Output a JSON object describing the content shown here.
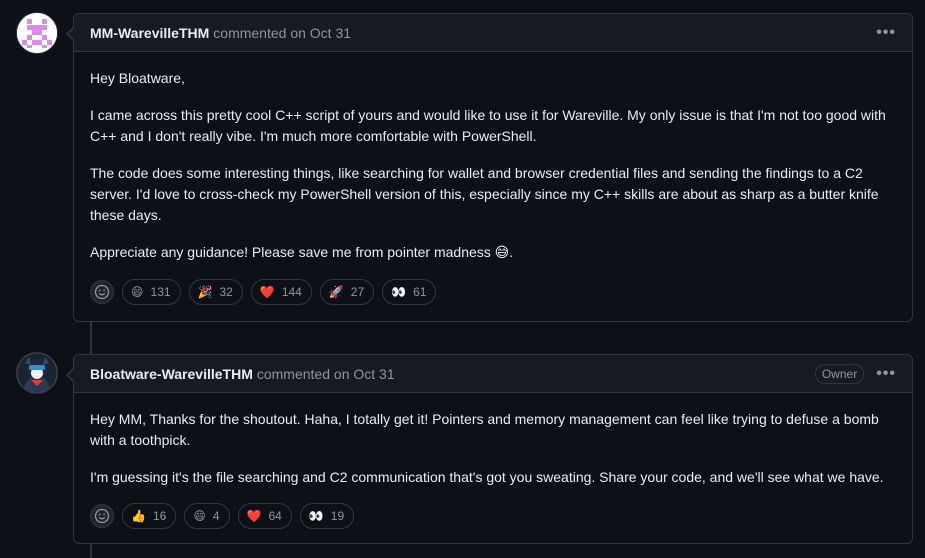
{
  "comments": [
    {
      "author": "MM-WarevilleTHM",
      "action": "commented",
      "date": "on Oct 31",
      "paragraphs": [
        "Hey Bloatware,",
        "I came across this pretty cool C++ script of yours and would like to use it for Wareville. My only issue is that I'm not too good with C++ and I don't really vibe. I'm much more comfortable with PowerShell.",
        "The code does some interesting things, like searching for wallet and browser credential files and sending the findings to a C2 server. I'd love to cross-check my PowerShell version of this, especially since my C++ skills are about as sharp as a butter knife these days.",
        "Appreciate any guidance! Please save me from pointer madness"
      ],
      "trailing_emoji": "😅",
      "trailing_punct": ".",
      "reactions": [
        {
          "emoji": "😄",
          "count": "131",
          "icon": "smile-icon"
        },
        {
          "emoji": "🎉",
          "count": "32",
          "icon": "tada-icon"
        },
        {
          "emoji": "❤️",
          "count": "144",
          "icon": "heart-icon"
        },
        {
          "emoji": "🚀",
          "count": "27",
          "icon": "rocket-icon"
        },
        {
          "emoji": "👀",
          "count": "61",
          "icon": "eyes-icon"
        }
      ]
    },
    {
      "author": "Bloatware-WarevilleTHM",
      "action": "commented",
      "date": "on Oct 31",
      "badge": "Owner",
      "paragraphs": [
        "Hey MM, Thanks for the shoutout. Haha, I totally get it! Pointers and memory management can feel like trying to defuse a bomb with a toothpick.",
        "I'm guessing it's the file searching and C2 communication that's got you sweating. Share your code, and we'll see what we have."
      ],
      "reactions": [
        {
          "emoji": "👍",
          "count": "16",
          "icon": "thumbsup-icon"
        },
        {
          "emoji": "😄",
          "count": "4",
          "icon": "smile-icon"
        },
        {
          "emoji": "❤️",
          "count": "64",
          "icon": "heart-icon"
        },
        {
          "emoji": "👀",
          "count": "19",
          "icon": "eyes-icon"
        }
      ]
    }
  ],
  "colors": {
    "background": "#0d1117",
    "header_bg": "#161b22",
    "border": "#30363d",
    "text": "#e6edf3",
    "muted": "#8d96a0",
    "identicon": "#d98ce8"
  },
  "icons": {
    "kebab": "kebab-horizontal-icon",
    "add_reaction": "smiley-add-reaction-icon"
  }
}
